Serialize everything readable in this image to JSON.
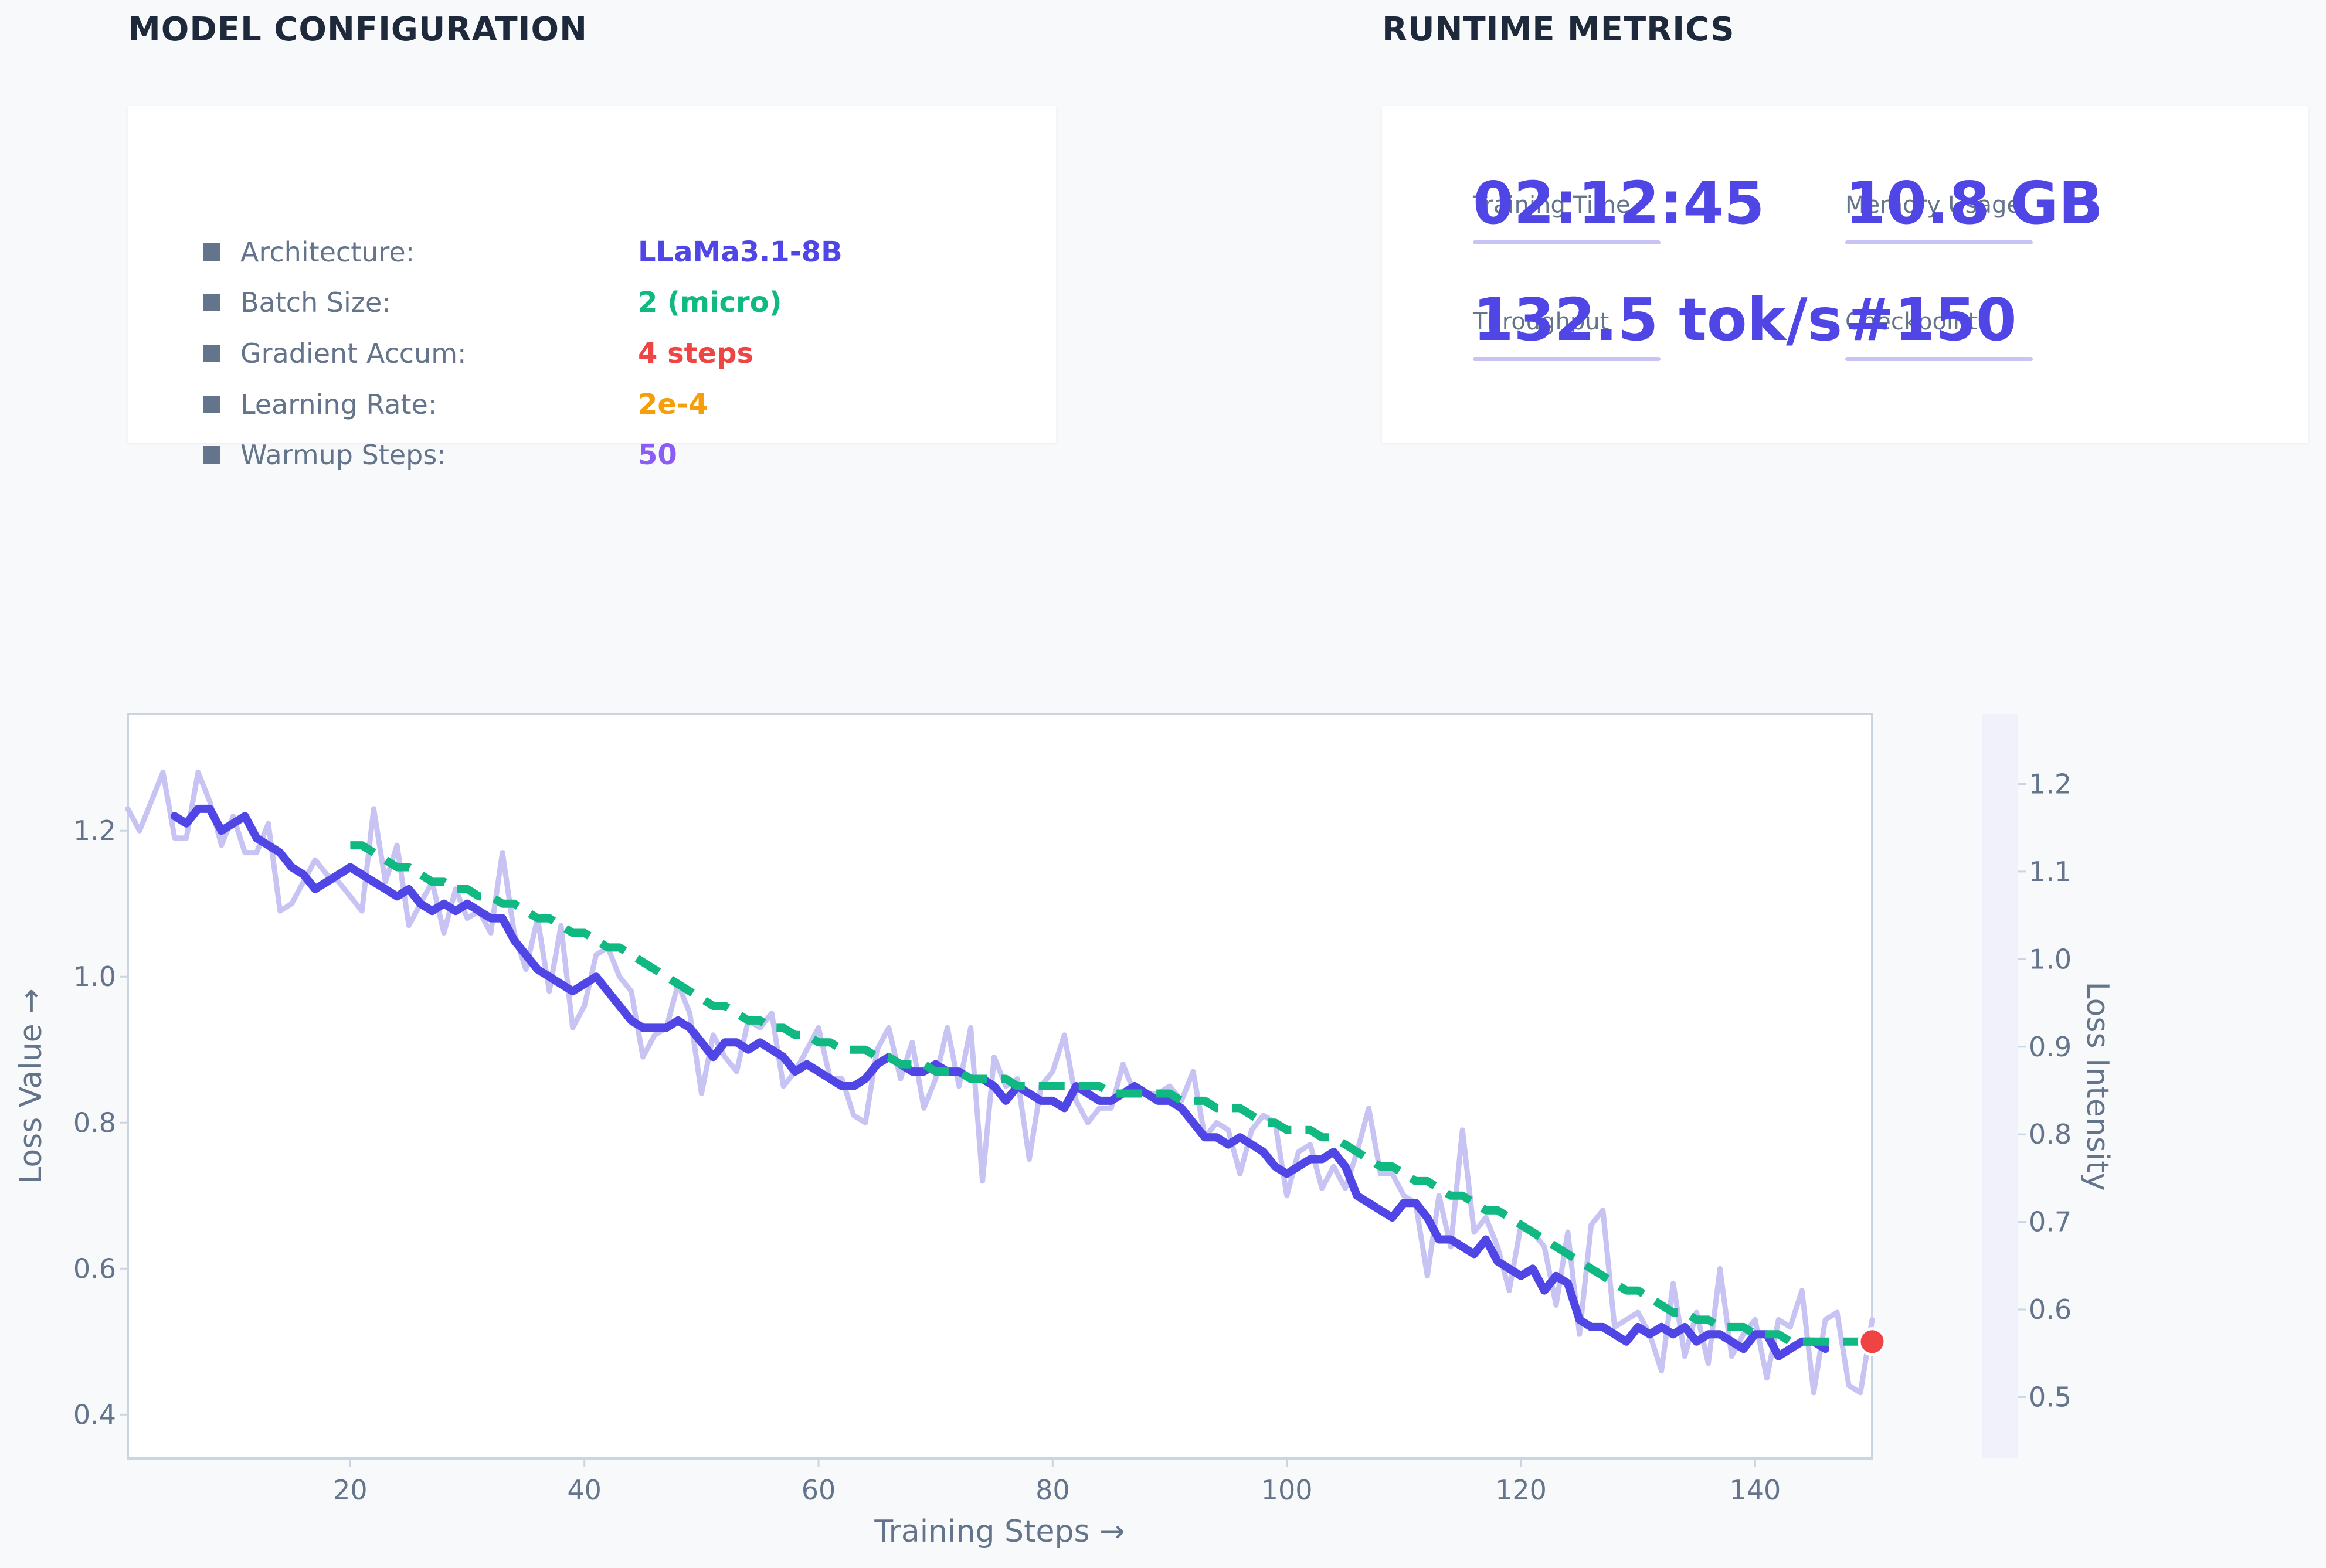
{
  "config": {
    "title": "MODEL CONFIGURATION",
    "rows": [
      {
        "label": "Architecture:",
        "value": "LLaMa3.1-8B",
        "color": "#4f46e5"
      },
      {
        "label": "Batch Size:",
        "value": "2 (micro)",
        "color": "#10b981"
      },
      {
        "label": "Gradient Accum:",
        "value": "4 steps",
        "color": "#ef4444"
      },
      {
        "label": "Learning Rate:",
        "value": "2e-4",
        "color": "#f59e0b"
      },
      {
        "label": "Warmup Steps:",
        "value": "50",
        "color": "#8b5cf6"
      }
    ]
  },
  "metrics": {
    "title": "RUNTIME METRICS",
    "items": [
      {
        "label": "Training Time",
        "value": "02:12:45"
      },
      {
        "label": "Memory Usage",
        "value": "10.8 GB"
      },
      {
        "label": "Throughput",
        "value": "132.5 tok/s"
      },
      {
        "label": "Checkpoint",
        "value": "#150"
      }
    ]
  },
  "chart_data": {
    "type": "line",
    "xlabel": "Training Steps →",
    "ylabel": "Loss Value →",
    "y2label": "Loss Intensity",
    "xlim": [
      1,
      150
    ],
    "ylim": [
      0.34,
      1.36
    ],
    "y2lim": [
      0.43,
      1.28
    ],
    "xticks": [
      20,
      40,
      60,
      80,
      100,
      120,
      140
    ],
    "yticks": [
      0.4,
      0.6,
      0.8,
      1.0,
      1.2
    ],
    "y2ticks": [
      0.5,
      0.6,
      0.7,
      0.8,
      0.9,
      1.0,
      1.1,
      1.2
    ],
    "colors": {
      "raw": "#c7c4f3",
      "smoothed": "#4f46e5",
      "trend": "#10b981",
      "current": "#ef4444"
    },
    "series": [
      {
        "name": "",
        "style": "raw",
        "x_start": 1,
        "values": [
          1.23,
          1.2,
          1.24,
          1.28,
          1.19,
          1.19,
          1.28,
          1.24,
          1.18,
          1.22,
          1.17,
          1.17,
          1.21,
          1.09,
          1.1,
          1.13,
          1.16,
          1.14,
          1.13,
          1.11,
          1.09,
          1.23,
          1.13,
          1.18,
          1.07,
          1.1,
          1.13,
          1.06,
          1.12,
          1.08,
          1.09,
          1.06,
          1.17,
          1.06,
          1.01,
          1.08,
          0.98,
          1.07,
          0.93,
          0.96,
          1.03,
          1.04,
          1.0,
          0.98,
          0.89,
          0.92,
          0.93,
          0.99,
          0.95,
          0.84,
          0.92,
          0.89,
          0.87,
          0.94,
          0.93,
          0.95,
          0.85,
          0.87,
          0.9,
          0.93,
          0.86,
          0.86,
          0.81,
          0.8,
          0.9,
          0.93,
          0.86,
          0.91,
          0.82,
          0.86,
          0.93,
          0.85,
          0.93,
          0.72,
          0.89,
          0.85,
          0.86,
          0.75,
          0.85,
          0.87,
          0.92,
          0.83,
          0.8,
          0.82,
          0.82,
          0.88,
          0.84,
          0.84,
          0.84,
          0.85,
          0.83,
          0.87,
          0.78,
          0.8,
          0.79,
          0.73,
          0.79,
          0.81,
          0.8,
          0.7,
          0.76,
          0.77,
          0.71,
          0.74,
          0.71,
          0.76,
          0.82,
          0.73,
          0.73,
          0.7,
          0.69,
          0.59,
          0.7,
          0.63,
          0.79,
          0.65,
          0.67,
          0.63,
          0.57,
          0.66,
          0.65,
          0.63,
          0.55,
          0.65,
          0.51,
          0.66,
          0.68,
          0.52,
          0.53,
          0.54,
          0.51,
          0.46,
          0.58,
          0.48,
          0.54,
          0.47,
          0.6,
          0.48,
          0.51,
          0.53,
          0.45,
          0.53,
          0.52,
          0.57,
          0.43,
          0.53,
          0.54,
          0.44,
          0.43,
          0.53
        ]
      },
      {
        "name": "",
        "style": "smoothed",
        "x_start": 5,
        "values": [
          1.22,
          1.21,
          1.23,
          1.23,
          1.2,
          1.21,
          1.22,
          1.19,
          1.18,
          1.17,
          1.15,
          1.14,
          1.12,
          1.13,
          1.14,
          1.15,
          1.14,
          1.13,
          1.12,
          1.11,
          1.12,
          1.1,
          1.09,
          1.1,
          1.09,
          1.1,
          1.09,
          1.08,
          1.08,
          1.05,
          1.03,
          1.01,
          1.0,
          0.99,
          0.98,
          0.99,
          1.0,
          0.98,
          0.96,
          0.94,
          0.93,
          0.93,
          0.93,
          0.94,
          0.93,
          0.91,
          0.89,
          0.91,
          0.91,
          0.9,
          0.91,
          0.9,
          0.89,
          0.87,
          0.88,
          0.87,
          0.86,
          0.85,
          0.85,
          0.86,
          0.88,
          0.89,
          0.88,
          0.87,
          0.87,
          0.88,
          0.87,
          0.87,
          0.86,
          0.86,
          0.85,
          0.83,
          0.85,
          0.84,
          0.83,
          0.83,
          0.82,
          0.85,
          0.84,
          0.83,
          0.83,
          0.84,
          0.85,
          0.84,
          0.83,
          0.83,
          0.82,
          0.8,
          0.78,
          0.78,
          0.77,
          0.78,
          0.77,
          0.76,
          0.74,
          0.73,
          0.74,
          0.75,
          0.75,
          0.76,
          0.74,
          0.7,
          0.69,
          0.68,
          0.67,
          0.69,
          0.69,
          0.67,
          0.64,
          0.64,
          0.63,
          0.62,
          0.64,
          0.61,
          0.6,
          0.59,
          0.6,
          0.57,
          0.59,
          0.58,
          0.53,
          0.52,
          0.52,
          0.51,
          0.5,
          0.52,
          0.51,
          0.52,
          0.51,
          0.52,
          0.5,
          0.51,
          0.51,
          0.5,
          0.49,
          0.51,
          0.51,
          0.48,
          0.49,
          0.5,
          0.5,
          0.49
        ]
      },
      {
        "name": "",
        "style": "trend",
        "x_start": 20,
        "values": [
          1.18,
          1.18,
          1.17,
          1.16,
          1.15,
          1.15,
          1.14,
          1.13,
          1.13,
          1.12,
          1.12,
          1.11,
          1.11,
          1.1,
          1.1,
          1.09,
          1.08,
          1.08,
          1.07,
          1.06,
          1.06,
          1.05,
          1.04,
          1.04,
          1.03,
          1.02,
          1.01,
          1.0,
          0.99,
          0.98,
          0.97,
          0.96,
          0.96,
          0.95,
          0.94,
          0.94,
          0.93,
          0.93,
          0.92,
          0.92,
          0.91,
          0.91,
          0.9,
          0.9,
          0.9,
          0.89,
          0.89,
          0.88,
          0.88,
          0.88,
          0.87,
          0.87,
          0.87,
          0.86,
          0.86,
          0.86,
          0.86,
          0.85,
          0.85,
          0.85,
          0.85,
          0.85,
          0.85,
          0.85,
          0.85,
          0.84,
          0.84,
          0.84,
          0.84,
          0.84,
          0.84,
          0.83,
          0.83,
          0.83,
          0.82,
          0.82,
          0.82,
          0.81,
          0.8,
          0.8,
          0.79,
          0.79,
          0.79,
          0.78,
          0.78,
          0.77,
          0.76,
          0.75,
          0.74,
          0.74,
          0.73,
          0.72,
          0.72,
          0.71,
          0.7,
          0.7,
          0.69,
          0.68,
          0.68,
          0.67,
          0.66,
          0.65,
          0.64,
          0.63,
          0.62,
          0.61,
          0.6,
          0.59,
          0.58,
          0.57,
          0.57,
          0.56,
          0.55,
          0.54,
          0.54,
          0.53,
          0.53,
          0.52,
          0.52,
          0.52,
          0.51,
          0.51,
          0.51,
          0.5,
          0.5,
          0.5,
          0.5,
          0.5,
          0.5,
          0.5
        ]
      }
    ],
    "current_point": {
      "x": 150,
      "y": 0.5
    }
  }
}
